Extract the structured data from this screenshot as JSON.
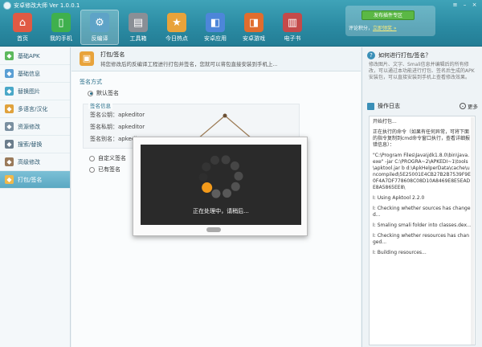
{
  "header": {
    "title": "安卓修改大师 Ver 1.0.0.1",
    "toolbar": [
      {
        "label": "首页",
        "icon": "home-icon",
        "color": "#e05a44"
      },
      {
        "label": "我的手机",
        "icon": "phone-icon",
        "color": "#3fb04d"
      },
      {
        "label": "反编译",
        "icon": "decompile-icon",
        "color": "#5ea3c7",
        "active": true
      },
      {
        "label": "工具箱",
        "icon": "toolbox-icon",
        "color": "#8a8f96"
      },
      {
        "label": "今日热点",
        "icon": "star-icon",
        "color": "#e8a33b"
      },
      {
        "label": "安卓应用",
        "icon": "apps-icon",
        "color": "#4d86d9"
      },
      {
        "label": "安卓游戏",
        "icon": "game-icon",
        "color": "#e06d2e"
      },
      {
        "label": "电子书",
        "icon": "book-icon",
        "color": "#c44a4a"
      }
    ],
    "promo_button": "发布插件专区",
    "promo_text": "评论积分，",
    "promo_link": "立即领奖 »"
  },
  "sidebar": [
    {
      "label": "基础APK",
      "color": "#5cb85c"
    },
    {
      "label": "基础信息",
      "color": "#5a9fd4"
    },
    {
      "label": "替换图片",
      "color": "#4aa8c8"
    },
    {
      "label": "多语言/汉化",
      "color": "#e0a23c"
    },
    {
      "label": "资源修改",
      "color": "#7a8fa0"
    },
    {
      "label": "搜索/替换",
      "color": "#6b7d8c"
    },
    {
      "label": "高级修改",
      "color": "#9a7a5a"
    },
    {
      "label": "打包/签名",
      "color": "#f0b84a",
      "active": true
    }
  ],
  "main": {
    "title": "打包/签名",
    "description": "将您修改后的反编译工程进行打包并签名，您就可以将包直接安装到手机上...",
    "sign_mode_label": "签名方式",
    "default_sign": "默认签名",
    "sig_legend": "签名信息",
    "sig_rows": [
      "签名公钥：apkeditor",
      "签名私钥：apkeditor",
      "签名别名：apkeditor"
    ],
    "custom_sign": "自定义签名",
    "no_sign": "已有签名"
  },
  "modal": {
    "text": "正在处理中，请稍后..."
  },
  "right": {
    "help_title": "如何进行打包/签名？",
    "help_body": "修改图片、文字、Smali信息并编辑后的所有修改，可以通过本功能进行打包、签名后生成的APK安装包，可以直接安装到手机上查看修改效果。",
    "log_title": "操作日志",
    "more_label": "更多",
    "log_lines": [
      "开始打包...",
      "正在执行的命令（如果有任何异常，可将下面的指令复制到cmd命令窗口执行，查看详细报错信息）：",
      "\"C:\\Program Files\\Java\\jdk1.8.0\\bin\\java.exe\" -jar C:\\PROGRA~2\\APKEDI~1\\tools\\apktool.jar b d:\\ApkHelperData\\cache\\uncompiled\\5E25001E4CB27B2B7539F9E0F4A7DF778608C08D10A8469E8E5EADE8A5865EE8\\",
      "I: Using Apktool 2.2.0",
      "I: Checking whether sources has changed...",
      "I: Smaling smali folder into classes.dex...",
      "I: Checking whether resources has changed...",
      "I: Building resources..."
    ]
  }
}
